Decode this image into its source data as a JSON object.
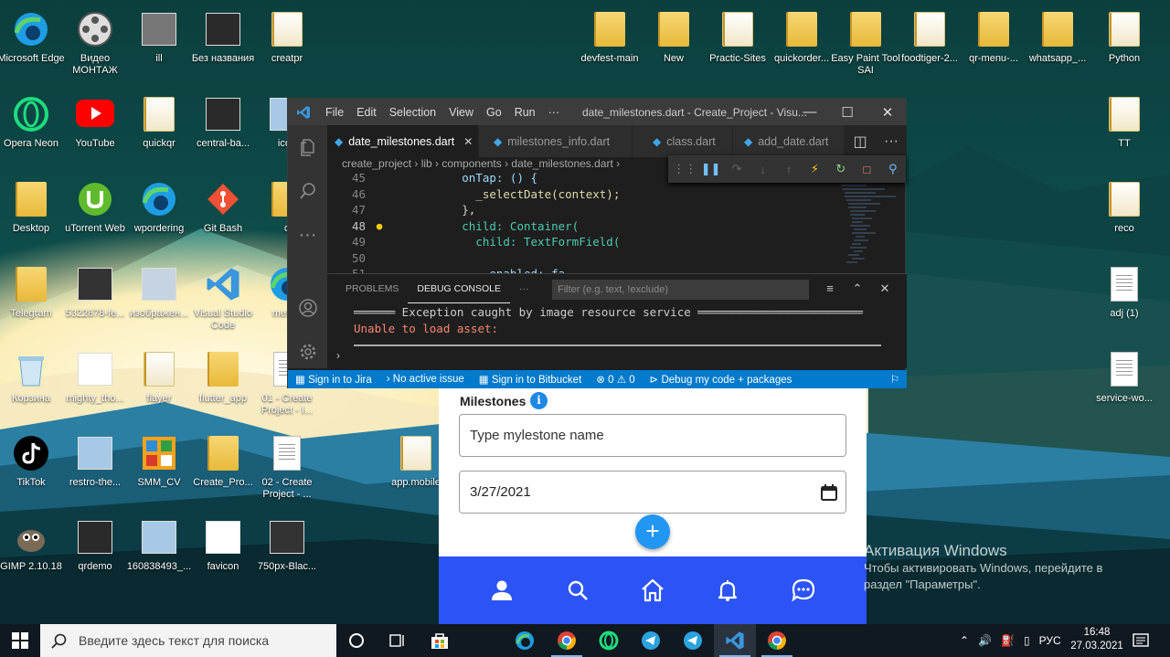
{
  "desktop": {
    "icons": [
      {
        "label": "Microsoft Edge",
        "kind": "edge-icon"
      },
      {
        "label": "Видео МОНТАЖ",
        "kind": "film-reel-icon"
      },
      {
        "label": "ill",
        "kind": "image-icon"
      },
      {
        "label": "Без названия",
        "kind": "image-icon"
      },
      {
        "label": "creatpr",
        "kind": "folder-icon"
      },
      {
        "label": "devfest-main",
        "kind": "folder-icon"
      },
      {
        "label": "New",
        "kind": "folder-icon"
      },
      {
        "label": "Practic-Sites",
        "kind": "folder-icon"
      },
      {
        "label": "quickorder...",
        "kind": "folder-icon"
      },
      {
        "label": "Easy Paint Tool SAI",
        "kind": "folder-icon"
      },
      {
        "label": "foodtiger-2...",
        "kind": "folder-icon"
      },
      {
        "label": "qr-menu-...",
        "kind": "folder-icon"
      },
      {
        "label": "whatsapp_...",
        "kind": "folder-icon"
      },
      {
        "label": "Python",
        "kind": "folder-icon"
      },
      {
        "label": "Opera Neon",
        "kind": "opera-icon"
      },
      {
        "label": "YouTube",
        "kind": "youtube-icon"
      },
      {
        "label": "quickqr",
        "kind": "folder-icon"
      },
      {
        "label": "central-ba...",
        "kind": "image-icon"
      },
      {
        "label": "icon",
        "kind": "image-icon"
      },
      {
        "label": "TT",
        "kind": "folder-icon"
      },
      {
        "label": "Desktop",
        "kind": "folder-icon"
      },
      {
        "label": "uTorrent Web",
        "kind": "utorrent-icon"
      },
      {
        "label": "wpordering",
        "kind": "edge-icon"
      },
      {
        "label": "Git Bash",
        "kind": "git-icon"
      },
      {
        "label": "d",
        "kind": "folder-icon"
      },
      {
        "label": "reco",
        "kind": "folder-icon"
      },
      {
        "label": "Telegram",
        "kind": "folder-icon"
      },
      {
        "label": "5322878-fe...",
        "kind": "image-icon"
      },
      {
        "label": "изображен...",
        "kind": "image-icon"
      },
      {
        "label": "Visual Studio Code",
        "kind": "vscode-icon"
      },
      {
        "label": "messa",
        "kind": "edge-icon"
      },
      {
        "label": "adj (1)",
        "kind": "document-icon"
      },
      {
        "label": "Корзина",
        "kind": "recycle-bin-icon"
      },
      {
        "label": "mighty_tho...",
        "kind": "image-icon"
      },
      {
        "label": "flayer",
        "kind": "folder-icon"
      },
      {
        "label": "flutter_app",
        "kind": "folder-icon"
      },
      {
        "label": "01 - Create Project - I...",
        "kind": "document-icon"
      },
      {
        "label": "service-wo...",
        "kind": "document-icon"
      },
      {
        "label": "TikTok",
        "kind": "tiktok-icon"
      },
      {
        "label": "restro-the...",
        "kind": "image-icon"
      },
      {
        "label": "SMM_CV",
        "kind": "archive-icon"
      },
      {
        "label": "Create_Pro...",
        "kind": "folder-icon"
      },
      {
        "label": "02 - Create Project - ...",
        "kind": "document-icon"
      },
      {
        "label": "app.mobile",
        "kind": "folder-icon"
      },
      {
        "label": "GIMP 2.10.18",
        "kind": "gimp-icon"
      },
      {
        "label": "qrdemo",
        "kind": "image-icon"
      },
      {
        "label": "160838493_...",
        "kind": "image-icon"
      },
      {
        "label": "favicon",
        "kind": "image-icon"
      },
      {
        "label": "750px-Blac...",
        "kind": "image-icon"
      }
    ]
  },
  "vscode": {
    "menu": [
      "File",
      "Edit",
      "Selection",
      "View",
      "Go",
      "Run",
      "···"
    ],
    "window_title": "date_milestones.dart - Create_Project - Visu...",
    "tabs": [
      {
        "label": "date_milestones.dart",
        "active": true
      },
      {
        "label": "milestones_info.dart",
        "active": false
      },
      {
        "label": "class.dart",
        "active": false
      },
      {
        "label": "add_date.dart",
        "active": false
      }
    ],
    "breadcrumb": "create_project › lib › components › date_milestones.dart › ",
    "code_lines": [
      {
        "num": "45",
        "text": "          onTap: () {"
      },
      {
        "num": "46",
        "text": "            _selectDate(context);"
      },
      {
        "num": "47",
        "text": "          },"
      },
      {
        "num": "48",
        "text": "          child: Container("
      },
      {
        "num": "49",
        "text": "            child: TextFormField("
      },
      {
        "num": "50",
        "text": ""
      },
      {
        "num": "51",
        "text": "              enabled: fa"
      }
    ],
    "panel": {
      "tabs": [
        "PROBLEMS",
        "DEBUG CONSOLE",
        "···"
      ],
      "filter_placeholder": "Filter (e.g. text, !exclude)",
      "line1": "══════ Exception caught by image resource service ════════════════════════",
      "line2": "Unable to load asset:",
      "prompt": "›"
    },
    "status": {
      "jira": "Sign in to Jira",
      "issue": "No active issue",
      "bitbucket": "Sign in to Bitbucket",
      "errors": "0",
      "warnings": "0",
      "debug": "Debug my code + packages"
    }
  },
  "app": {
    "section_title": "Milestones",
    "name_placeholder": "Type mylestone name",
    "date_value": "3/27/2021",
    "fab_label": "+",
    "nav": [
      "person-icon",
      "search-icon",
      "home-icon",
      "bell-icon",
      "chat-icon"
    ],
    "nav_color": "#2c53f5"
  },
  "activation": {
    "title": "Активация Windows",
    "text": "Чтобы активировать Windows, перейдите в раздел \"Параметры\"."
  },
  "taskbar": {
    "search_placeholder": "Введите здесь текст для поиска",
    "lang": "РУС",
    "time": "16:48",
    "date": "27.03.2021"
  }
}
